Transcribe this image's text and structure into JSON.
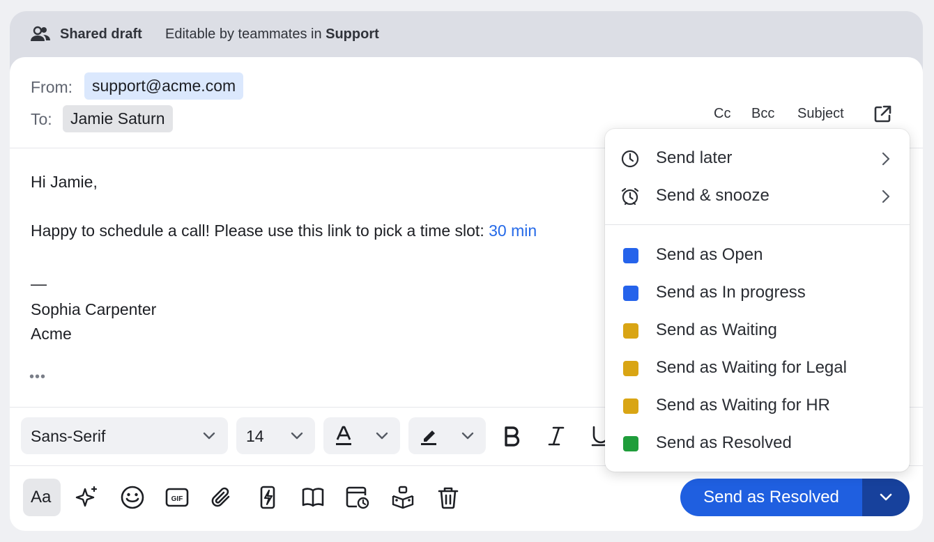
{
  "shared_bar": {
    "title": "Shared draft",
    "subtitle_prefix": "Editable by teammates in",
    "team": "Support"
  },
  "header": {
    "from_label": "From:",
    "from_value": "support@acme.com",
    "to_label": "To:",
    "to_value": "Jamie Saturn",
    "cc": "Cc",
    "bcc": "Bcc",
    "subject": "Subject"
  },
  "body": {
    "greeting": "Hi Jamie,",
    "line1_text": "Happy to schedule a call! Please use this link to pick a time slot:",
    "line1_link": "30 min",
    "dash": "—",
    "signature_name": "Sophia Carpenter",
    "signature_company": "Acme",
    "ellipsis": "•••"
  },
  "formatting": {
    "font": "Sans-Serif",
    "size": "14"
  },
  "send": {
    "label": "Send as Resolved"
  },
  "menu": {
    "send_later": "Send later",
    "send_snooze": "Send & snooze",
    "statuses": [
      {
        "label": "Send as Open",
        "color": "#2563eb"
      },
      {
        "label": "Send as In progress",
        "color": "#2563eb"
      },
      {
        "label": "Send as Waiting",
        "color": "#d9a514"
      },
      {
        "label": "Send as Waiting for Legal",
        "color": "#d9a514"
      },
      {
        "label": "Send as Waiting for HR",
        "color": "#d9a514"
      },
      {
        "label": "Send as Resolved",
        "color": "#1f9d3b"
      }
    ]
  },
  "icons": {
    "shared": "users-icon",
    "popout": "external-link-icon",
    "bottom": [
      "text-format-icon",
      "sparkle-icon",
      "emoji-icon",
      "gif-icon",
      "attachment-icon",
      "lightning-icon",
      "book-icon",
      "calendar-clock-icon",
      "hierarchy-icon",
      "trash-icon"
    ]
  }
}
